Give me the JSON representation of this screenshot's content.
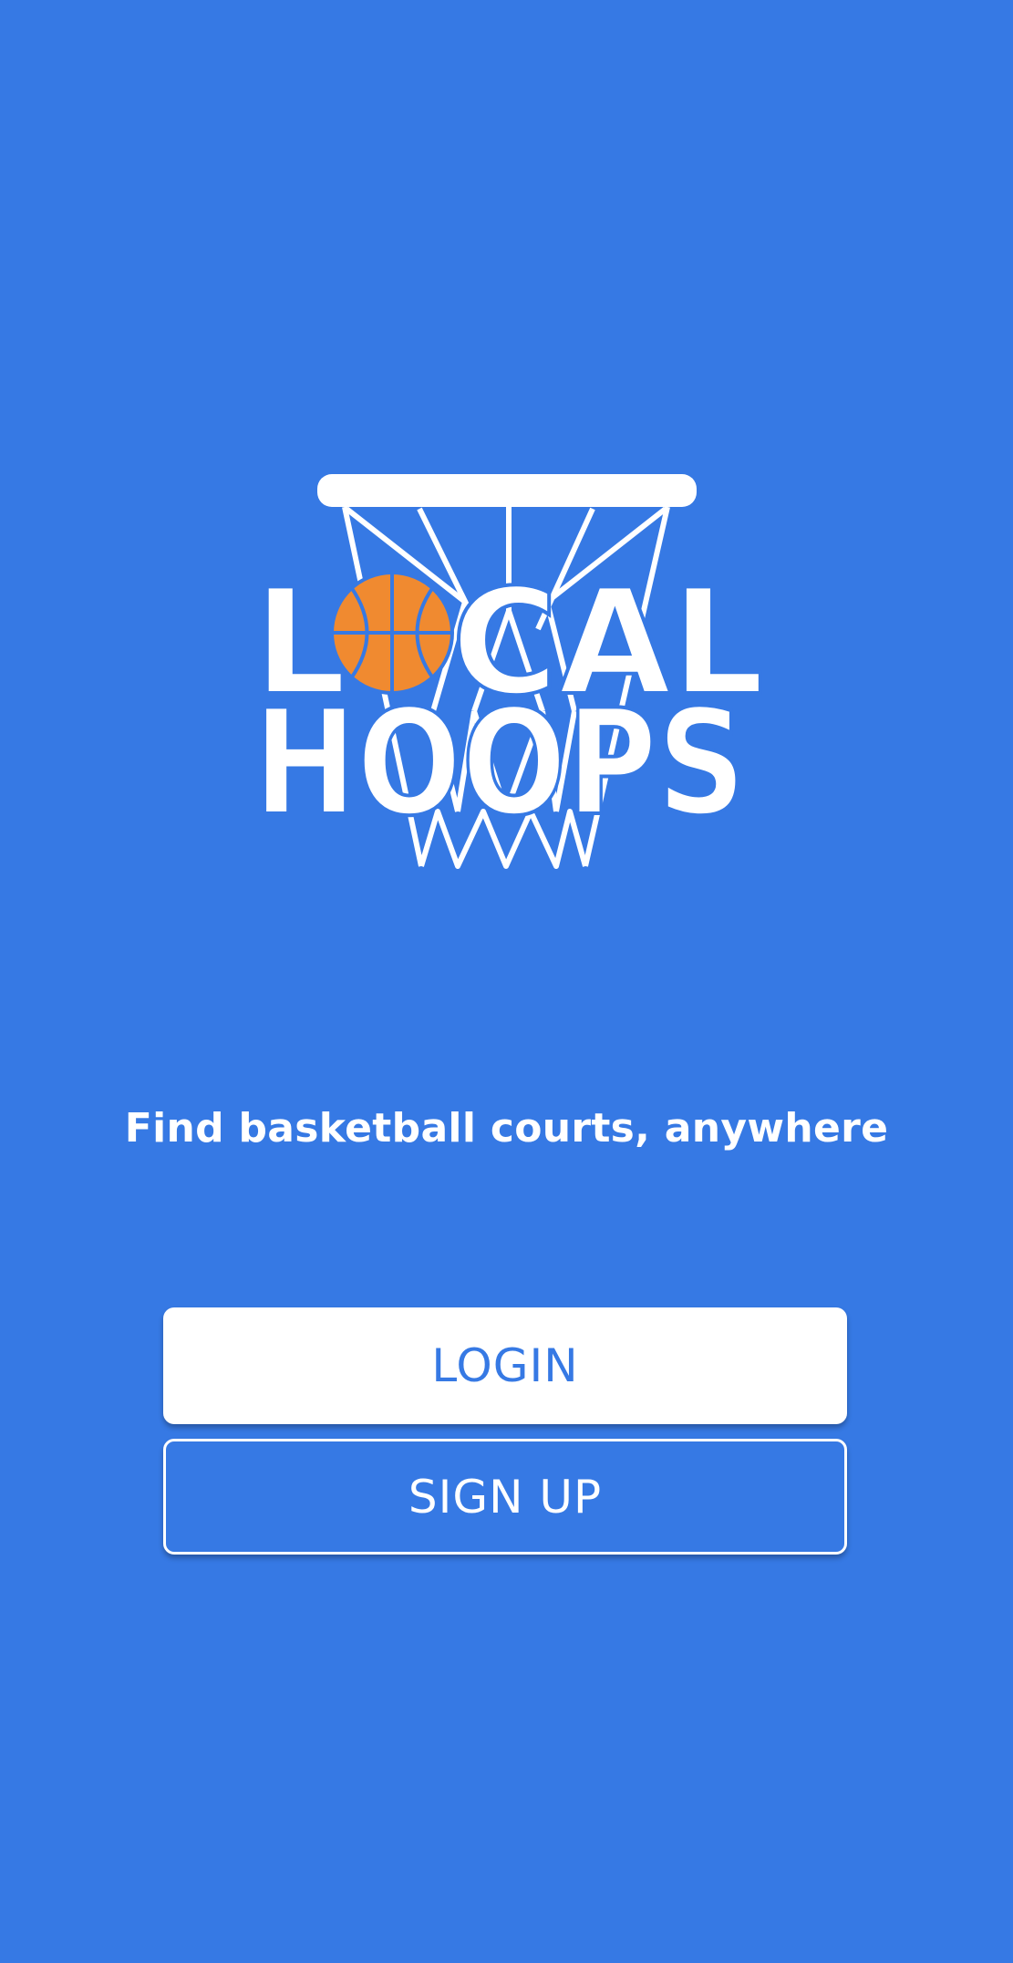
{
  "app": {
    "logo_text": [
      "LOCAL",
      "HOOPS"
    ],
    "tagline": "Find basketball courts, anywhere"
  },
  "actions": {
    "login_label": "LOGIN",
    "signup_label": "SIGN UP"
  },
  "colors": {
    "background": "#3679E4",
    "ball": "#F08A30",
    "text_light": "#FFFFFF",
    "button_primary_bg": "#FFFFFF",
    "button_primary_text": "#3679E4"
  },
  "icons": {
    "logo": "basketball-hoop-icon",
    "ball": "basketball-icon"
  }
}
